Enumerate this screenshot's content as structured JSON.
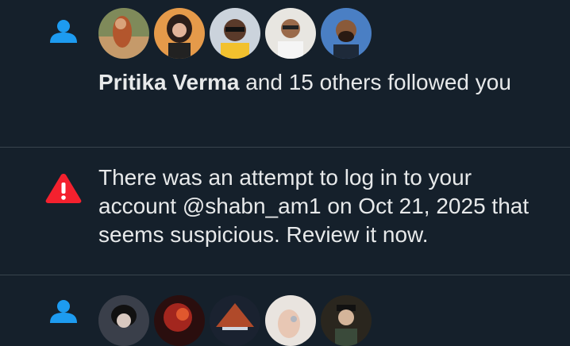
{
  "notifications": [
    {
      "type": "follow",
      "icon": "person-icon",
      "accent_color": "#1d9bf0",
      "avatars": [
        "avatar-1",
        "avatar-2",
        "avatar-3",
        "avatar-4",
        "avatar-5"
      ],
      "name": "Pritika Verma",
      "rest": " and 15 others followed you"
    },
    {
      "type": "alert",
      "icon": "alert-icon",
      "accent_color": "#f4212e",
      "text": "There was an attempt to log in to your account @shabn_am1 on Oct 21, 2025 that seems suspicious. Review it now."
    },
    {
      "type": "follow",
      "icon": "person-icon",
      "accent_color": "#1d9bf0",
      "avatars": [
        "avatar-1",
        "avatar-2",
        "avatar-3",
        "avatar-4",
        "avatar-5"
      ]
    }
  ],
  "colors": {
    "background": "#15202b",
    "text": "#e7e9ea",
    "divider": "#38444d"
  }
}
